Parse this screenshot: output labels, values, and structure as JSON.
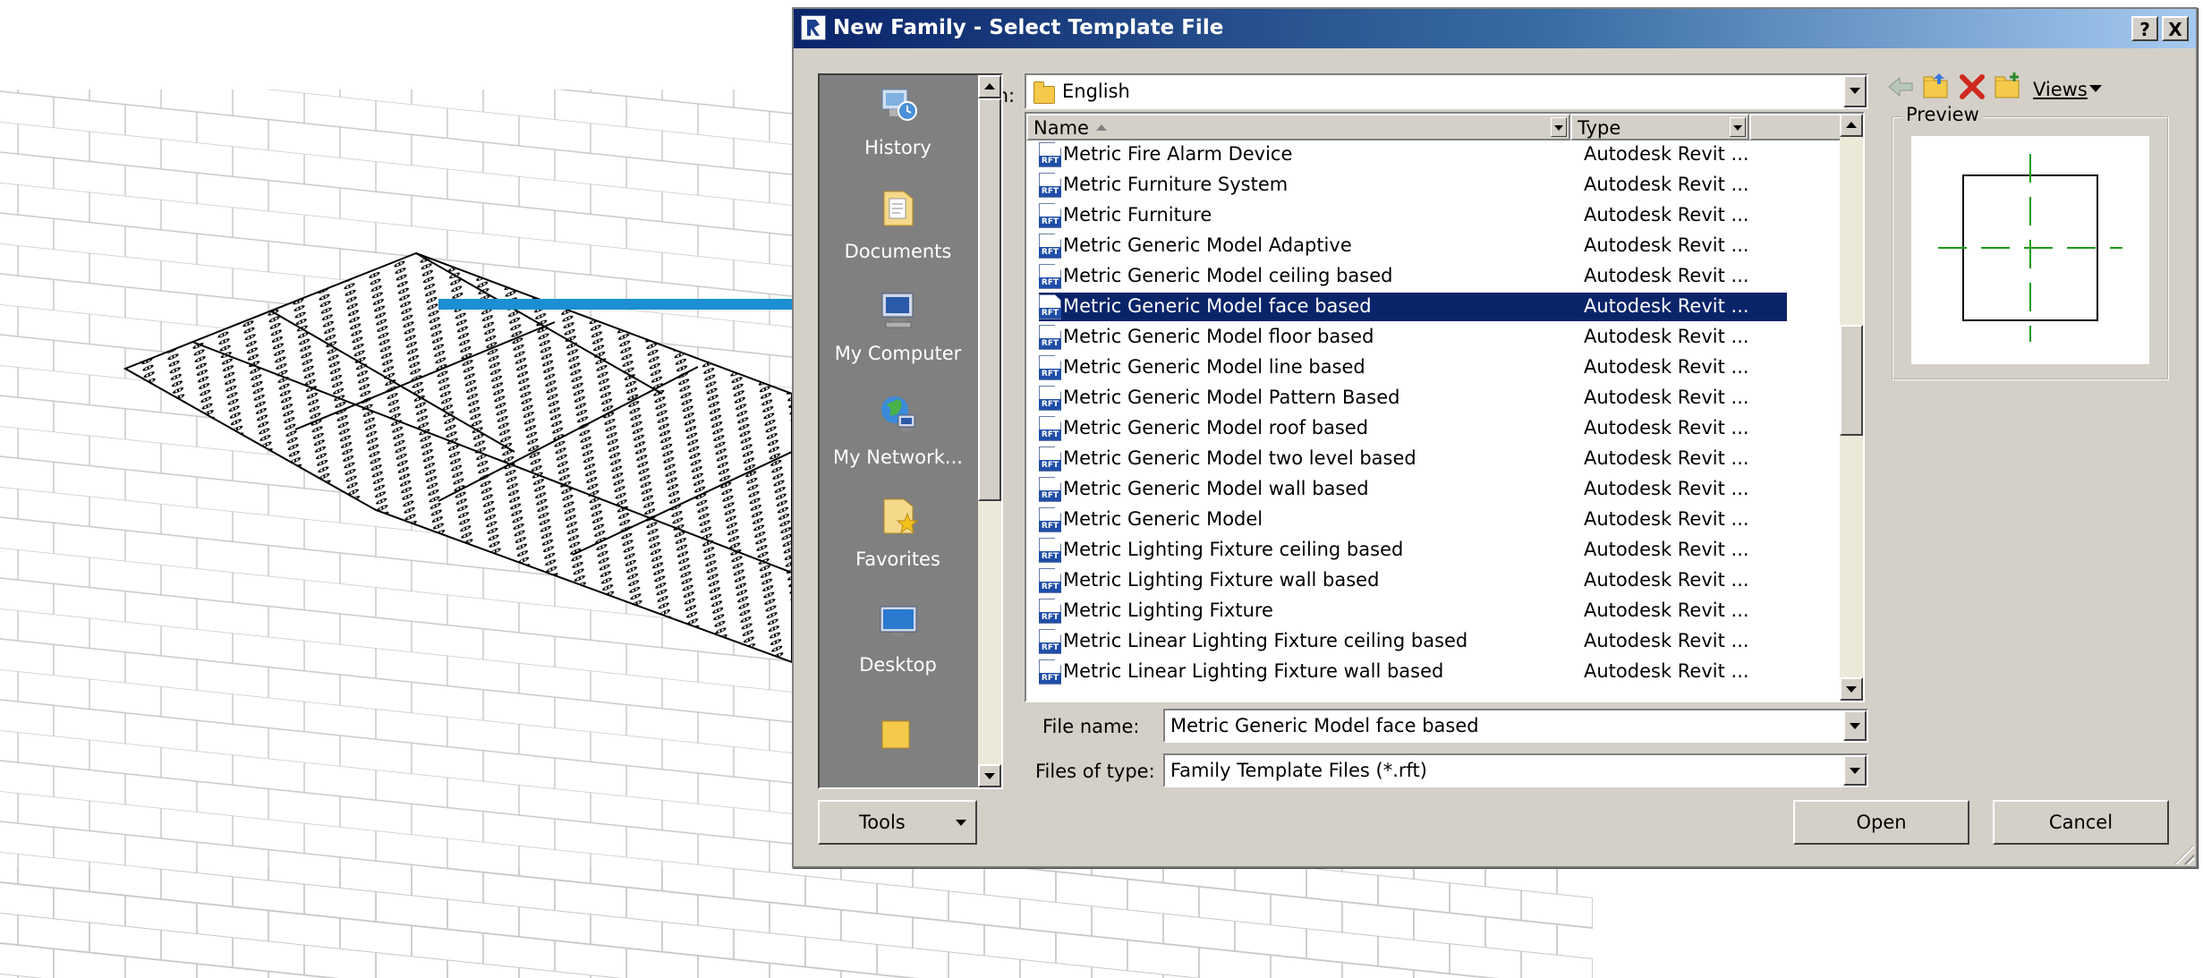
{
  "dialog": {
    "title": "New Family - Select Template File",
    "help_label": "?",
    "close_label": "X",
    "look_in_label": "Look in:",
    "look_in_value": "English",
    "views_label": "Views",
    "preview_label": "Preview"
  },
  "places": [
    {
      "label": "History",
      "icon": "history-icon"
    },
    {
      "label": "Documents",
      "icon": "documents-icon"
    },
    {
      "label": "My Computer",
      "icon": "computer-icon"
    },
    {
      "label": "My Network...",
      "icon": "network-icon"
    },
    {
      "label": "Favorites",
      "icon": "favorites-icon"
    },
    {
      "label": "Desktop",
      "icon": "desktop-icon"
    }
  ],
  "file_list": {
    "columns": {
      "name": "Name",
      "type": "Type"
    },
    "rows": [
      {
        "name": "Metric Fire Alarm Device",
        "type": "Autodesk Revit ..."
      },
      {
        "name": "Metric Furniture System",
        "type": "Autodesk Revit ..."
      },
      {
        "name": "Metric Furniture",
        "type": "Autodesk Revit ..."
      },
      {
        "name": "Metric Generic Model Adaptive",
        "type": "Autodesk Revit ..."
      },
      {
        "name": "Metric Generic Model ceiling based",
        "type": "Autodesk Revit ..."
      },
      {
        "name": "Metric Generic Model face based",
        "type": "Autodesk Revit ...",
        "selected": true
      },
      {
        "name": "Metric Generic Model floor based",
        "type": "Autodesk Revit ..."
      },
      {
        "name": "Metric Generic Model line based",
        "type": "Autodesk Revit ..."
      },
      {
        "name": "Metric Generic Model Pattern Based",
        "type": "Autodesk Revit ..."
      },
      {
        "name": "Metric Generic Model roof based",
        "type": "Autodesk Revit ..."
      },
      {
        "name": "Metric Generic Model two level based",
        "type": "Autodesk Revit ..."
      },
      {
        "name": "Metric Generic Model wall based",
        "type": "Autodesk Revit ..."
      },
      {
        "name": "Metric Generic Model",
        "type": "Autodesk Revit ..."
      },
      {
        "name": "Metric Lighting Fixture ceiling based",
        "type": "Autodesk Revit ..."
      },
      {
        "name": "Metric Lighting Fixture wall based",
        "type": "Autodesk Revit ..."
      },
      {
        "name": "Metric Lighting Fixture",
        "type": "Autodesk Revit ..."
      },
      {
        "name": "Metric Linear Lighting Fixture ceiling based",
        "type": "Autodesk Revit ..."
      },
      {
        "name": "Metric Linear Lighting Fixture wall based",
        "type": "Autodesk Revit ..."
      }
    ],
    "file_icon_tag": "RFT"
  },
  "file_name": {
    "label": "File name:",
    "value": "Metric Generic Model face based"
  },
  "file_type": {
    "label": "Files of type:",
    "value": "Family Template Files  (*.rft)"
  },
  "buttons": {
    "tools": "Tools",
    "open": "Open",
    "cancel": "Cancel"
  },
  "colors": {
    "title_start": "#0a246a",
    "title_end": "#a6caf0",
    "selection": "#0a246a",
    "arrow": "#1a8fd1",
    "dialog_face": "#d4d0c8"
  }
}
